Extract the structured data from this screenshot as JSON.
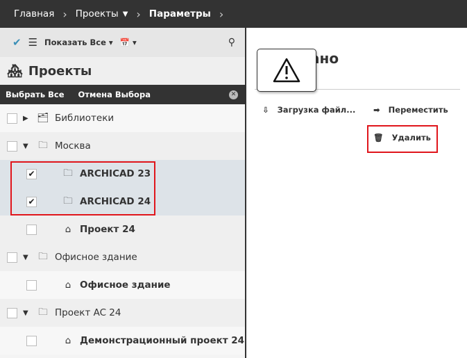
{
  "breadcrumb": {
    "items": [
      "Главная",
      "Проекты",
      "Параметры"
    ]
  },
  "toolbar": {
    "show_all": "Показать Все"
  },
  "panel": {
    "title": "Проекты",
    "select_all": "Выбрать Все",
    "deselect": "Отмена Выбора"
  },
  "tree": [
    {
      "label": "Библиотеки",
      "checked": false
    },
    {
      "label": "Москва",
      "checked": false
    },
    {
      "label": "ARCHICAD 23",
      "checked": true
    },
    {
      "label": "ARCHICAD 24",
      "checked": true
    },
    {
      "label": "Проект 24",
      "checked": false
    },
    {
      "label": "Офисное здание",
      "checked": false
    },
    {
      "label": "Офисное здание",
      "checked": false
    },
    {
      "label": "Проект AC 24",
      "checked": false
    },
    {
      "label": "Демонстрационный проект 24",
      "checked": false
    }
  ],
  "right": {
    "title_fragment": "ано",
    "upload": "Загрузка файл...",
    "move": "Переместить",
    "delete": "Удалить"
  },
  "colors": {
    "highlight": "#e0151b",
    "dark": "#333333"
  }
}
